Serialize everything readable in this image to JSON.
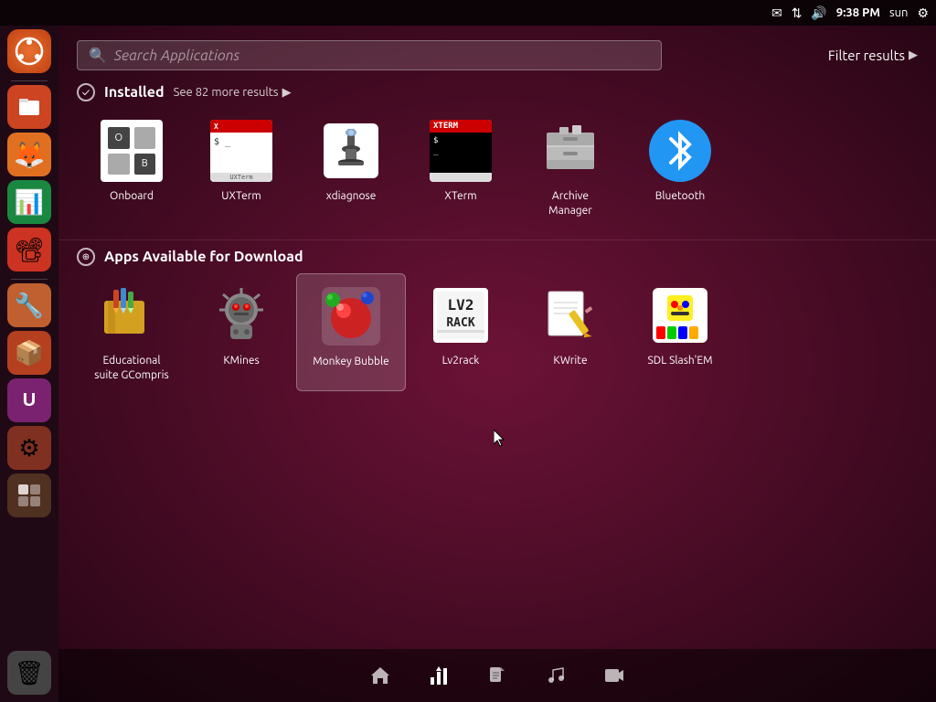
{
  "topPanel": {
    "icons": [
      "✉",
      "⇅",
      "🔊"
    ],
    "time": "9:38 PM",
    "user": "sun",
    "gear": "⚙"
  },
  "searchBar": {
    "placeholder": "Search Applications",
    "filterLabel": "Filter results"
  },
  "installed": {
    "sectionTitle": "Installed",
    "moreText": "See 82 more results",
    "apps": [
      {
        "name": "Onboard",
        "icon": "onboard"
      },
      {
        "name": "UXTerm",
        "icon": "uxterm"
      },
      {
        "name": "xdiagnose",
        "icon": "xdiagnose"
      },
      {
        "name": "XTerm",
        "icon": "xterm"
      },
      {
        "name": "Archive Manager",
        "icon": "archive"
      },
      {
        "name": "Bluetooth",
        "icon": "bluetooth"
      }
    ]
  },
  "downloadable": {
    "sectionTitle": "Apps Available for Download",
    "apps": [
      {
        "name": "Educational suite GCompris",
        "icon": "gcompris"
      },
      {
        "name": "KMines",
        "icon": "kmines"
      },
      {
        "name": "Monkey Bubble",
        "icon": "monkeybubble"
      },
      {
        "name": "Lv2rack",
        "icon": "lv2rack"
      },
      {
        "name": "KWrite",
        "icon": "kwrite"
      },
      {
        "name": "SDL Slash'EM",
        "icon": "sdl"
      }
    ]
  },
  "filterBar": {
    "buttons": [
      {
        "icon": "🏠",
        "name": "home-filter"
      },
      {
        "icon": "📊",
        "name": "apps-filter"
      },
      {
        "icon": "📄",
        "name": "files-filter"
      },
      {
        "icon": "🎵",
        "name": "music-filter"
      },
      {
        "icon": "▶",
        "name": "video-filter"
      }
    ]
  },
  "launcher": {
    "apps": [
      {
        "icon": "🔵",
        "color": "#e05010",
        "name": "ubuntu-home"
      },
      {
        "icon": "📁",
        "color": "#c43",
        "name": "files"
      },
      {
        "icon": "🦊",
        "color": "#e07020",
        "name": "firefox"
      },
      {
        "icon": "📊",
        "color": "#1a8",
        "name": "libreoffice-calc"
      },
      {
        "icon": "📽",
        "color": "#c33",
        "name": "libreoffice-impress"
      },
      {
        "icon": "🔧",
        "color": "#c63",
        "name": "system-settings"
      },
      {
        "icon": "📦",
        "color": "#b52",
        "name": "software-center"
      },
      {
        "icon": "🅤",
        "color": "#7a2270",
        "name": "ubuntu-one"
      },
      {
        "icon": "⚙",
        "color": "#888",
        "name": "system-tools"
      },
      {
        "icon": "🗑",
        "color": "#555",
        "name": "trash"
      }
    ]
  }
}
